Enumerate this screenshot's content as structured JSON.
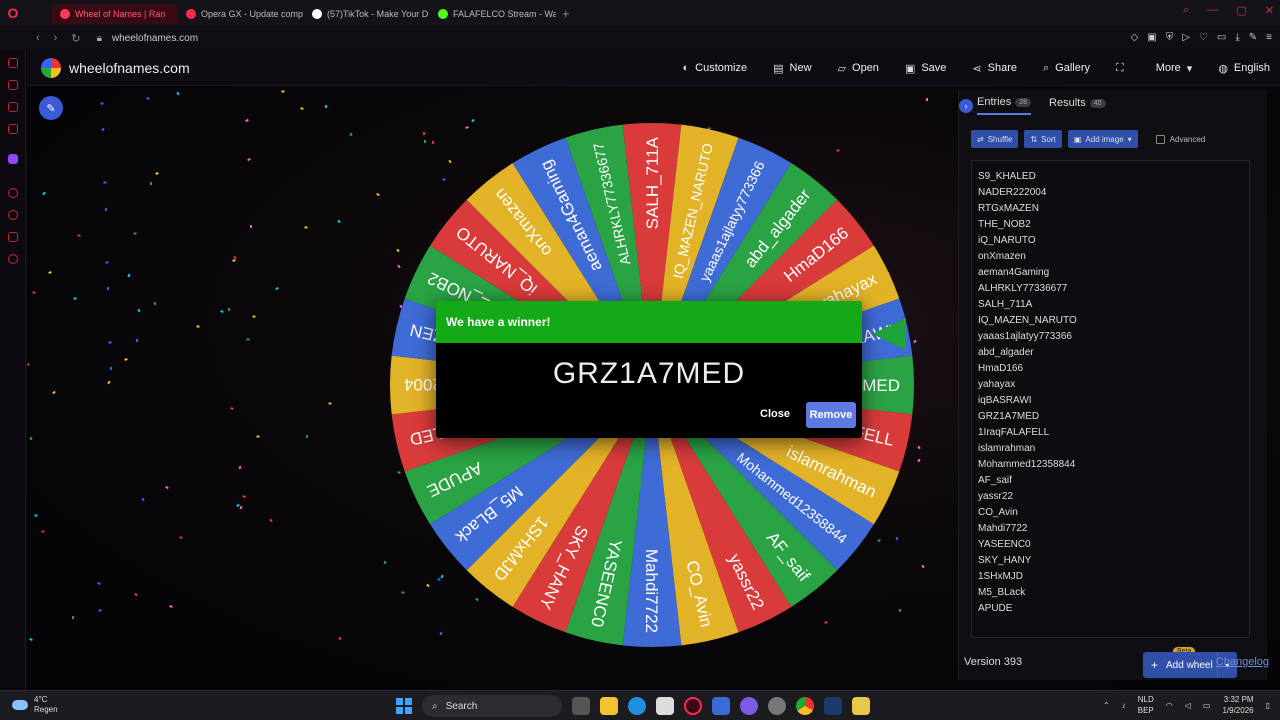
{
  "browser": {
    "tabs": [
      {
        "label": "Wheel of Names | Ran",
        "active": true,
        "color": "#ff3b5c"
      },
      {
        "label": "Opera GX - Update comp",
        "active": false,
        "color": "#ff2b4a"
      },
      {
        "label": "(57)TikTok - Make Your D",
        "active": false,
        "color": "#ffffff"
      },
      {
        "label": "FALAFELCO Stream - Wat",
        "active": false,
        "color": "#53fc18"
      }
    ],
    "new_tab": "+",
    "url": "wheelofnames.com"
  },
  "site": {
    "brand": "wheelofnames.com",
    "menu": [
      {
        "label": "Customize",
        "icon": "palette-icon"
      },
      {
        "label": "New",
        "icon": "file-icon"
      },
      {
        "label": "Open",
        "icon": "folder-icon"
      },
      {
        "label": "Save",
        "icon": "save-icon"
      },
      {
        "label": "Share",
        "icon": "share-icon"
      },
      {
        "label": "Gallery",
        "icon": "search-icon"
      },
      {
        "label": "",
        "icon": "fullscreen-icon"
      },
      {
        "label": "More",
        "icon": "chevron-down-icon"
      },
      {
        "label": "English",
        "icon": "globe-icon"
      }
    ]
  },
  "wheel": {
    "colors": [
      "#2aa344",
      "#d93b3b",
      "#e2b227",
      "#3f6bd6"
    ],
    "segments": [
      "GRZ1A7MED",
      "1IraqFALAFELL",
      "islamrahman",
      "Mohammed12358844",
      "AF_saif",
      "yassr22",
      "CO_Avin",
      "Mahdi7722",
      "YASEENC0",
      "SKY_HANY",
      "1SHxMJD",
      "M5_BLack",
      "APUDE",
      "S9_KHALED",
      "NADER222004",
      "RTGxMAZEN",
      "THE_NOB2",
      "iQ_NARUTO",
      "onXmazen",
      "aeman4Gaming",
      "ALHRKLY77336677",
      "SALH_711A",
      "IQ_MAZEN_NARUTO",
      "yaaas1ajlatyy773366",
      "abd_algader",
      "HmaD166",
      "yahayax",
      "iqBASRAWI"
    ]
  },
  "dialog": {
    "title": "We have a winner!",
    "winner": "GRZ1A7MED",
    "close_label": "Close",
    "remove_label": "Remove",
    "header_color": "#14a916"
  },
  "panel": {
    "tabs": [
      {
        "label": "Entries",
        "count": "28"
      },
      {
        "label": "Results",
        "count": "40"
      }
    ],
    "toolbar": {
      "shuffle": "Shuffle",
      "sort": "Sort",
      "add_image": "Add image",
      "advanced": "Advanced"
    },
    "entries": [
      "S9_KHALED",
      "NADER222004",
      "RTGxMAZEN",
      "THE_NOB2",
      "iQ_NARUTO",
      "onXmazen",
      "aeman4Gaming",
      "ALHRKLY77336677",
      "SALH_711A",
      "IQ_MAZEN_NARUTO",
      "yaaas1ajlatyy773366",
      "abd_algader",
      "HmaD166",
      "yahayax",
      "iqBASRAWI",
      "GRZ1A7MED",
      "1IraqFALAFELL",
      "islamrahman",
      "Mohammed12358844",
      "AF_saif",
      "yassr22",
      "CO_Avin",
      "Mahdi7722",
      "YASEENC0",
      "SKY_HANY",
      "1SHxMJD",
      "M5_BLack",
      "APUDE"
    ],
    "beta": "Beta",
    "add_wheel": "Add wheel",
    "version": "Version 393",
    "changelog": "Changelog"
  },
  "taskbar": {
    "weather_temp": "4°C",
    "weather_desc": "Regen",
    "search": "Search",
    "lang_top": "NLD",
    "lang_bottom": "BEP",
    "time": "3:32 PM",
    "date": "1/9/2026"
  }
}
